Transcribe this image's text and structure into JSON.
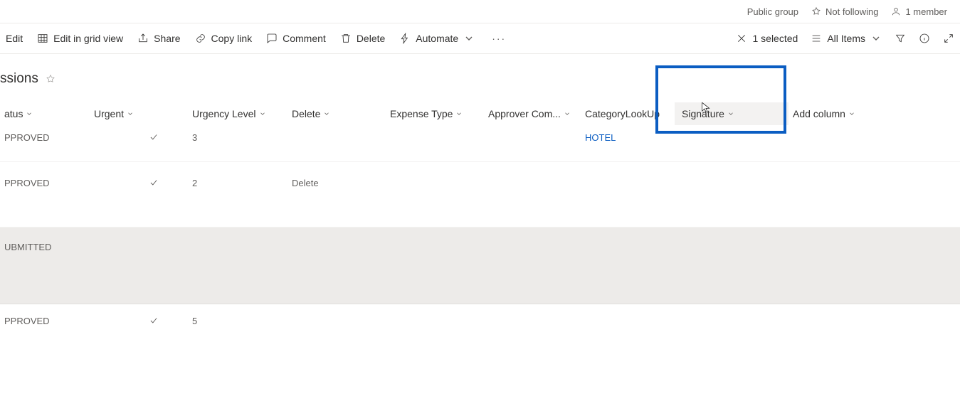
{
  "topmeta": {
    "group_type": "Public group",
    "following": "Not following",
    "members": "1 member"
  },
  "toolbar": {
    "edit": "Edit",
    "grid": "Edit in grid view",
    "share": "Share",
    "copylink": "Copy link",
    "comment": "Comment",
    "delete": "Delete",
    "automate": "Automate",
    "selected": "1 selected",
    "allitems": "All Items"
  },
  "list": {
    "title": "ssions"
  },
  "columns": {
    "status": "atus",
    "urgent": "Urgent",
    "urgency_level": "Urgency Level",
    "delete": "Delete",
    "expense_type": "Expense Type",
    "approver_com": "Approver Com...",
    "category_lookup": "CategoryLookUp",
    "signature": "Signature",
    "add_column": "Add column"
  },
  "rows": [
    {
      "status": "PPROVED",
      "urgent": true,
      "urgency_level": "3",
      "delete_text": "",
      "category": "HOTEL"
    },
    {
      "status": "PPROVED",
      "urgent": true,
      "urgency_level": "2",
      "delete_text": "Delete",
      "category": ""
    },
    {
      "status": "UBMITTED",
      "urgent": false,
      "urgency_level": "",
      "delete_text": "",
      "category": ""
    },
    {
      "status": "PPROVED",
      "urgent": true,
      "urgency_level": "5",
      "delete_text": "",
      "category": ""
    }
  ]
}
